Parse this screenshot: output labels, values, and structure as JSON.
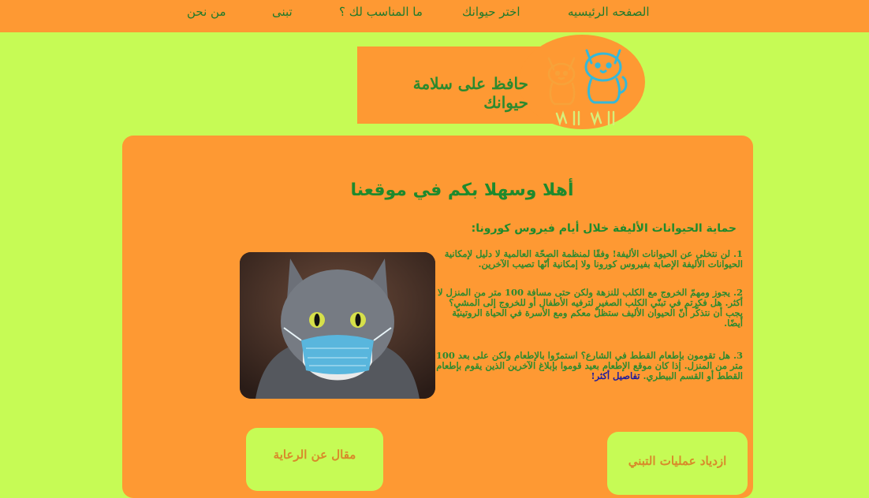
{
  "nav": {
    "items": [
      {
        "label": "الصفحه الرئيسيه"
      },
      {
        "label": "اختر حيوانك"
      },
      {
        "label": "ما المناسب لك ؟"
      },
      {
        "label": "تبنى"
      },
      {
        "label": "من نحن"
      }
    ]
  },
  "banner": {
    "title": "حافظ على سلامة حيوانك"
  },
  "main": {
    "welcome": "أهلا وسهلا بكم في موقعنا",
    "subtitle": "حماية الحيوانات الأليفة خلال أيام فيروس كورونا:",
    "paragraphs": {
      "p1": "1. لن نتخلى عن الحيوانات الأليفة! وفقًا لمنظمة الصحّة العالمية لا دليل لإمكانية الحيوانات الأليفة الإصابة بفيروس كورونا ولا إمكانية أنّها تصيب الآخرين.",
      "p2": "2. يجوز ومهمّ الخروج مع الكلب للنزهة ولكن حتى مسافة 100 متر من المنزل لا أكثر. هل فكرتم في تبنّي الكلب الصغير لترفيه الأطفال أو للخروج إلى المشي؟ يجب أن نتذكّر أنّ الحيوان الأليف ستظلّ معكم ومع الأسرة في الحياة الروتينيّة أيضًا.",
      "p3": "3. هل تقومون بإطعام القطط في الشارع؟ استمرّوا بالإطعام ولكن على بعد 100 متر من المنزل. إذا كان موقع الإطعام بعيد قوموا بإبلاغ الآخرين الذين يقوم بإطعام القطط أو القسم البيطري.",
      "more_link": "تفاصيل أكثر!"
    },
    "cards": {
      "adoption": "ازدياد عمليات التبني",
      "care_article": "مقال عن الرعاية"
    }
  },
  "colors": {
    "background": "#c6fb55",
    "orange": "#fe9933",
    "green_text": "#1e8a2d",
    "link": "#1a1aa0"
  },
  "icons": {
    "logo": "cats-logo-icon",
    "photo": "cat-with-mask-photo"
  }
}
